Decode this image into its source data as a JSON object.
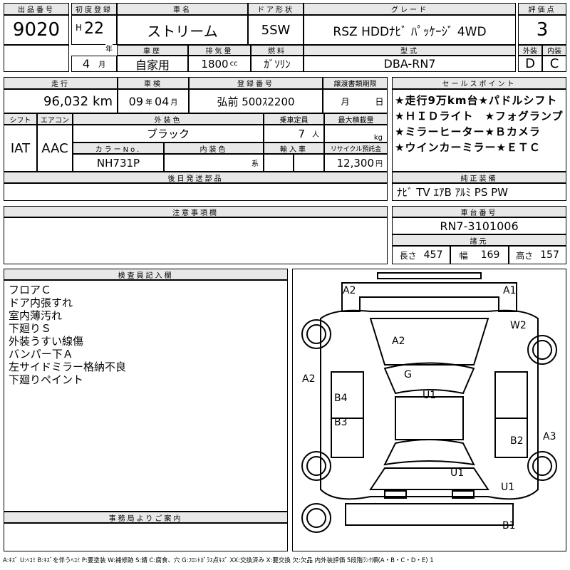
{
  "lot": {
    "header": "出品番号",
    "value": "9020"
  },
  "first_reg": {
    "header": "初度登録",
    "era": "H",
    "year": "22",
    "year_unit": "年",
    "month": "4",
    "month_unit": "月"
  },
  "car_name": {
    "header": "車名",
    "value": "ストリーム"
  },
  "door": {
    "header": "ドア形状",
    "value": "5SW"
  },
  "grade": {
    "header": "グレード",
    "value": "RSZ HDDﾅﾋﾞ ﾊﾟｯｹｰｼﾞ 4WD"
  },
  "score": {
    "header": "評価点",
    "value": "3",
    "ext_header": "外装",
    "int_header": "内装",
    "ext": "D",
    "int": "C"
  },
  "history": {
    "header": "車歴",
    "value": "自家用"
  },
  "displacement": {
    "header": "排気量",
    "value": "1800",
    "unit": "cc"
  },
  "fuel": {
    "header": "燃料",
    "value": "ｶﾞｿﾘﾝ"
  },
  "model": {
    "header": "型式",
    "value": "DBA-RN7"
  },
  "mileage": {
    "header": "走行",
    "value": "96,032",
    "unit": "km"
  },
  "inspection": {
    "header": "車検",
    "year": "09",
    "year_unit": "年",
    "month": "04",
    "month_unit": "月"
  },
  "registration": {
    "header": "登録番号",
    "value": "弘前 500ｽ2200"
  },
  "transfer": {
    "header": "譲渡書類期限",
    "month_unit": "月",
    "day_unit": "日"
  },
  "shift": {
    "header": "シフト",
    "value": "IAT"
  },
  "aircon": {
    "header": "エアコン",
    "value": "AAC"
  },
  "exterior_color": {
    "header": "外装色",
    "value": "ブラック"
  },
  "capacity": {
    "header": "乗車定員",
    "value": "7",
    "unit": "人"
  },
  "max_load": {
    "header": "最大積載量",
    "unit": "kg"
  },
  "color_no": {
    "header": "カラーNo.",
    "value": "NH731P"
  },
  "interior_color": {
    "header": "内装色",
    "unit": "系"
  },
  "import": {
    "header": "輸入車"
  },
  "recycle": {
    "header": "リサイクル預託金",
    "value": "12,300",
    "unit": "円"
  },
  "later_parts": {
    "header": "後日発送部品"
  },
  "notes_header": "注意事項欄",
  "sales_points": {
    "header": "セールスポイント",
    "items": [
      "★走行9万km台★パドルシフト",
      "★ＨＩＤライト　★フォグランプ",
      "★ミラーヒーター★Ｂカメラ",
      "★ウインカーミラー★ＥＴＣ"
    ]
  },
  "equipment": {
    "header": "純正装備",
    "value": "ﾅﾋﾞ TV ｴｱB ｱﾙﾐ PS PW"
  },
  "chassis": {
    "header": "車台番号",
    "value": "RN7-3101006"
  },
  "dims": {
    "header": "諸元",
    "length_label": "長さ",
    "length": "457",
    "width_label": "幅",
    "width": "169",
    "height_label": "高さ",
    "height": "157"
  },
  "inspector": {
    "header": "検査員記入欄",
    "notes": [
      "フロアＣ",
      "ドア内張すれ",
      "室内薄汚れ",
      "下廻りＳ",
      "外装うすい線傷",
      "バンパー下Ａ",
      "左サイドミラー格納不良",
      "下廻りペイント"
    ]
  },
  "office_header": "事務局よりご案内",
  "damage": {
    "A2_front": "A2",
    "A1": "A1",
    "W2": "W2",
    "A2_hood": "A2",
    "A2_side": "A2",
    "G": "G",
    "B4": "B4",
    "U1_roof": "U1",
    "B3": "B3",
    "A3": "A3",
    "B2": "B2",
    "U1_rear": "U1",
    "U1_corner": "U1",
    "B1": "B1"
  },
  "legend": "A:ｷｽﾞ U:ﾍｺﾐ B:ｷｽﾞを伴うﾍｺﾐ P:要塗装 W:補修跡 S:錆 C:腐食、穴 G:ﾌﾛﾝﾄｶﾞﾗｽ点ｷｽﾞ XX:交換済み X:要交換 欠:欠品 内外装評価 5段階ﾗﾝｸ順(A・B・C・D・E) 1"
}
